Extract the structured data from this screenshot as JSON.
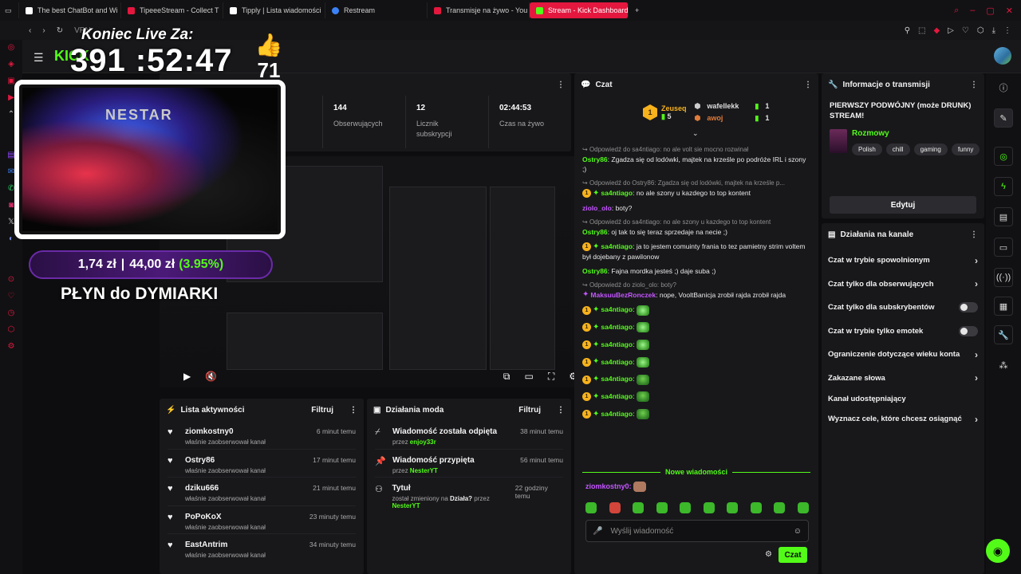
{
  "browser": {
    "tabs": [
      {
        "label": "The best ChatBot and Wi",
        "color": "#ffffff"
      },
      {
        "label": "TipeeeStream - Collect T",
        "color": "#e4173f"
      },
      {
        "label": "Tipply | Lista wiadomości",
        "color": "#ffffff"
      },
      {
        "label": "Restream",
        "color": "#3b82f6"
      },
      {
        "label": "Transmisje na żywo - You",
        "color": "#e4173f"
      },
      {
        "label": "Stream - Kick Dashboard",
        "color": "#53fc18"
      }
    ],
    "new_tab": "+",
    "vpn": "VPN"
  },
  "overlay": {
    "countdown_title": "Koniec Live Za:",
    "countdown": "391 :52:47",
    "kick_logo": "KICK",
    "likes": "71",
    "cam_banner": "NESTAR",
    "donate_current": "1,74 zł",
    "donate_sep": "|",
    "donate_goal": "44,00 zł",
    "donate_pct": "(3.95%)",
    "donate_label": "PŁYN do DYMIARKI"
  },
  "stats": [
    {
      "value": "144",
      "label": "Obserwujących"
    },
    {
      "value": "12",
      "label": "Licznik subskrypcji"
    },
    {
      "value": "02:44:53",
      "label": "Czas na żywo"
    }
  ],
  "activity": {
    "title": "Lista aktywności",
    "filter": "Filtruj",
    "items": [
      {
        "name": "ziomkostny0",
        "sub": "właśnie zaobserwował kanał",
        "time": "6 minut temu"
      },
      {
        "name": "Ostry86",
        "sub": "właśnie zaobserwował kanał",
        "time": "17 minut temu"
      },
      {
        "name": "dziku666",
        "sub": "właśnie zaobserwował kanał",
        "time": "21 minut temu"
      },
      {
        "name": "PoPoKoX",
        "sub": "właśnie zaobserwował kanał",
        "time": "23 minuty temu"
      },
      {
        "name": "EastAntrim",
        "sub": "właśnie zaobserwował kanał",
        "time": "34 minuty temu"
      }
    ]
  },
  "mod": {
    "title": "Działania moda",
    "filter": "Filtruj",
    "items": [
      {
        "name": "Wiadomość została odpięta",
        "by": "przez",
        "user": "enjoy33r",
        "time": "38 minut temu"
      },
      {
        "name": "Wiadomość przypięta",
        "by": "przez",
        "user": "NesterYT",
        "time": "56 minut temu"
      },
      {
        "name": "Tytuł",
        "by": "został zmieniony na",
        "bold": "Działa?",
        "by2": "przez",
        "user": "NesterYT",
        "time": "22 godziny temu"
      }
    ]
  },
  "chat": {
    "title": "Czat",
    "top": {
      "first_name": "Zeuseq",
      "first_count": "5",
      "second_name": "wafellekk",
      "second_count": "1",
      "third_name": "awoj",
      "third_count": "1",
      "rank": "1"
    },
    "messages": [
      {
        "reply": "Odpowiedź do sa4ntiago: no ale volt sie mocno rozwinał",
        "user": "Ostry86",
        "color": "#53fc18",
        "text": "Zgadza się od lodówki, majtek na krześle po podróże IRL i szony ;)"
      },
      {
        "reply": "Odpowiedź do Ostry86: Zgadza się od lodówki, majtek na krześle p...",
        "user": "sa4ntiago",
        "color": "#53fc18",
        "text": "no ale szony u kazdego to top kontent"
      },
      {
        "reply": "",
        "user": "ziolo_olo",
        "color": "#c455ff",
        "text": "boty?"
      },
      {
        "reply": "Odpowiedź do sa4ntiago: no ale szony u kazdego to top kontent",
        "user": "Ostry86",
        "color": "#53fc18",
        "text": "oj tak to się teraz sprzedaje na necie ;)"
      },
      {
        "reply": "",
        "user": "sa4ntiago",
        "color": "#53fc18",
        "text": "ja to jestem comuinty frania to tez pamietny strim voltem był dojebany z pawilonow"
      },
      {
        "reply": "",
        "user": "Ostry86",
        "color": "#53fc18",
        "text": "Fajna mordka jesteś ;) daje suba ;)"
      },
      {
        "reply": "Odpowiedź do ziolo_olo: boty?",
        "user": "MaksuuBezRonczek",
        "color": "#c455ff",
        "text": "nope, VooltBanicja zrobił rajda zrobił rajda"
      }
    ],
    "emote_user": "sa4ntiago",
    "new_messages": "Nowe wiadomości",
    "last_user": "ziomkostny0",
    "input_placeholder": "Wyślij wiadomość",
    "send_label": "Czat"
  },
  "info": {
    "title": "Informacje o transmisji",
    "stream_title": "PIERWSZY PODWÓJNY (może DRUNK) STREAM!",
    "category": "Rozmowy",
    "tags": [
      "Polish",
      "chill",
      "gaming",
      "funny"
    ],
    "edit_label": "Edytuj"
  },
  "channel": {
    "title": "Działania na kanale",
    "options": [
      {
        "label": "Czat w trybie spowolnionym",
        "kind": "chevron"
      },
      {
        "label": "Czat tylko dla obserwujących",
        "kind": "chevron"
      },
      {
        "label": "Czat tylko dla subskrybentów",
        "kind": "toggle"
      },
      {
        "label": "Czat w trybie tylko emotek",
        "kind": "toggle"
      },
      {
        "label": "Ograniczenie dotyczące wieku konta",
        "kind": "chevron"
      },
      {
        "label": "Zakazane słowa",
        "kind": "chevron"
      },
      {
        "label": "Kanał udostępniający",
        "kind": "none"
      },
      {
        "label": "Wyznacz cele, które chcesz osiągnąć",
        "kind": "chevron"
      }
    ]
  }
}
